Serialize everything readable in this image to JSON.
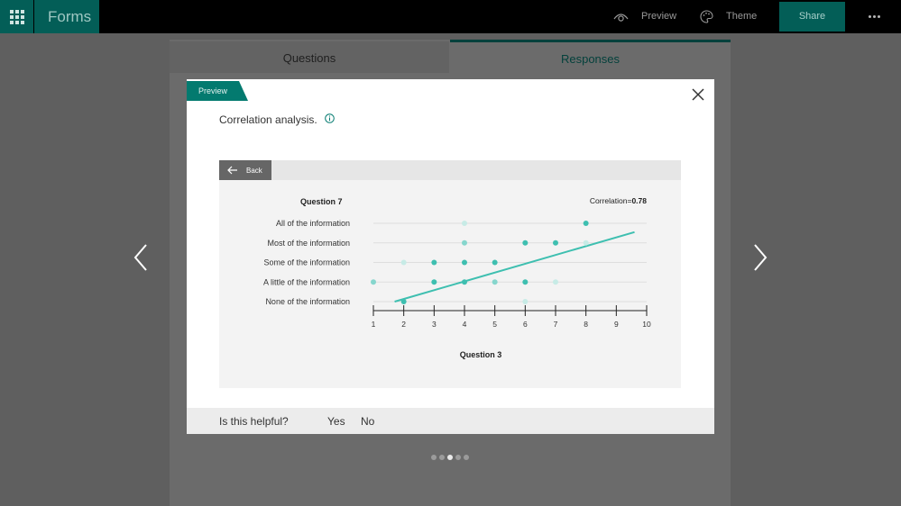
{
  "app": {
    "name": "Forms"
  },
  "topbar": {
    "preview_label": "Preview",
    "theme_label": "Theme",
    "share_label": "Share"
  },
  "tabs": [
    {
      "label": "Questions"
    },
    {
      "label": "Responses"
    }
  ],
  "dialog": {
    "tag": "Preview",
    "title": "Correlation analysis.",
    "back_label": "Back",
    "feedback_question": "Is this helpful?",
    "yes_label": "Yes",
    "no_label": "No"
  },
  "chart_data": {
    "type": "scatter",
    "title": "Question 7",
    "xlabel": "Question 3",
    "ylabel": "",
    "correlation_label": "Correlation=",
    "correlation": "0.78",
    "xlim": [
      1,
      10
    ],
    "x_ticks": [
      1,
      2,
      3,
      4,
      5,
      6,
      7,
      8,
      9,
      10
    ],
    "categories": [
      "All of the information",
      "Most of the information",
      "Some of the information",
      "A little of the information",
      "None of the information"
    ],
    "points": [
      {
        "x": 4,
        "cat": 0,
        "strength": "faint"
      },
      {
        "x": 8,
        "cat": 0,
        "strength": "strong"
      },
      {
        "x": 4,
        "cat": 1,
        "strength": "medium"
      },
      {
        "x": 6,
        "cat": 1,
        "strength": "strong"
      },
      {
        "x": 7,
        "cat": 1,
        "strength": "strong"
      },
      {
        "x": 8,
        "cat": 1,
        "strength": "faint"
      },
      {
        "x": 2,
        "cat": 2,
        "strength": "faint"
      },
      {
        "x": 3,
        "cat": 2,
        "strength": "strong"
      },
      {
        "x": 4,
        "cat": 2,
        "strength": "strong"
      },
      {
        "x": 5,
        "cat": 2,
        "strength": "strong"
      },
      {
        "x": 1,
        "cat": 3,
        "strength": "medium"
      },
      {
        "x": 3,
        "cat": 3,
        "strength": "strong"
      },
      {
        "x": 4,
        "cat": 3,
        "strength": "strong"
      },
      {
        "x": 5,
        "cat": 3,
        "strength": "medium"
      },
      {
        "x": 6,
        "cat": 3,
        "strength": "strong"
      },
      {
        "x": 7,
        "cat": 3,
        "strength": "faint"
      },
      {
        "x": 2,
        "cat": 4,
        "strength": "strong"
      },
      {
        "x": 6,
        "cat": 4,
        "strength": "faint"
      }
    ],
    "trend_line": {
      "from": {
        "x": 1.7,
        "cat": 4
      },
      "to": {
        "x": 9.6,
        "cat": 0.45
      }
    },
    "colors": {
      "strong": "#3ebfb0",
      "medium": "#86d6cd",
      "faint": "#c7ebe6",
      "trend": "#3ebfb0"
    }
  },
  "pager": {
    "count": 5,
    "active": 2
  }
}
